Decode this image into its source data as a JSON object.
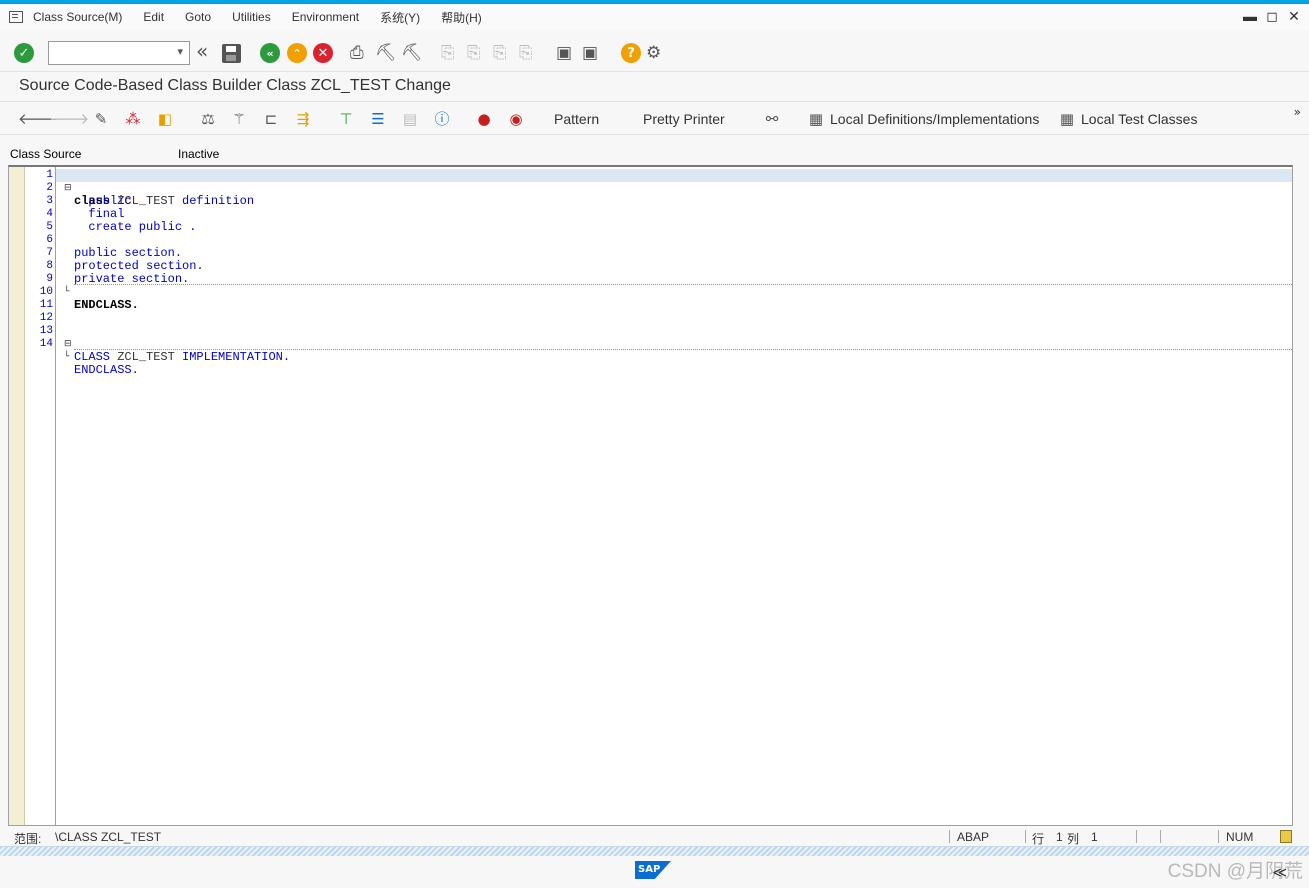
{
  "menubar": {
    "items": [
      "Class Source(M)",
      "Edit",
      "Goto",
      "Utilities",
      "Environment",
      "系统(Y)",
      "帮助(H)"
    ]
  },
  "window_controls": {
    "minimize": "▬",
    "restore": "◻",
    "close": "✕"
  },
  "toolbar": {
    "command_value": "",
    "icons": [
      "enter-icon",
      "command-dropdown-icon",
      "double-left-icon",
      "save-icon",
      "back-icon",
      "exit-icon",
      "cancel-icon",
      "print-icon",
      "find-icon",
      "find-next-icon",
      "first-page-icon",
      "previous-page-icon",
      "next-page-icon",
      "last-page-icon",
      "new-session-icon",
      "shortcut-icon",
      "help-icon",
      "settings-icon"
    ]
  },
  "page": {
    "title": "Source Code-Based Class Builder Class ZCL_TEST Change"
  },
  "app_toolbar": {
    "pattern_label": "Pattern",
    "pretty_printer_label": "Pretty Printer",
    "local_defs_label": "Local Definitions/Implementations",
    "local_tests_label": "Local Test Classes",
    "icons": [
      "back-arrow-icon",
      "forward-arrow-icon",
      "display-change-icon",
      "active-inactive-icon",
      "activate-icon",
      "check-icon",
      "magic-wand-icon",
      "where-used-icon",
      "navigate-icon",
      "hierarchy-icon",
      "outline-icon",
      "layout-icon",
      "info-icon",
      "breakpoint-icon",
      "external-breakpoint-icon",
      "dependency-icon",
      "local-defs-icon",
      "local-tests-icon"
    ],
    "more": "»"
  },
  "header": {
    "source_label": "Class Source",
    "status": "Inactive"
  },
  "editor": {
    "line_numbers": [
      "1",
      "2",
      "3",
      "4",
      "5",
      "6",
      "7",
      "8",
      "9",
      "10",
      "11",
      "12",
      "13",
      "14"
    ],
    "lines": {
      "l1a": "class",
      "l1b": " ZCL_TEST ",
      "l1c": "definition",
      "l2": "  public",
      "l3": "  final",
      "l4": "  create public .",
      "l6": "public section.",
      "l7": "protected section.",
      "l8": "private section.",
      "l9": "ENDCLASS.",
      "l13a": "CLASS",
      "l13b": " ZCL_TEST ",
      "l13c": "IMPLEMENTATION.",
      "l14": "ENDCLASS."
    },
    "fold_open": "⊟",
    "fold_end": "└"
  },
  "statusbar": {
    "scope_label": "范围:",
    "scope_value": "\\CLASS ZCL_TEST",
    "language": "ABAP",
    "row_label": "行",
    "row_value": "1",
    "col_label": "列",
    "col_value": "1",
    "mode": "NUM"
  },
  "footer": {
    "logo": "SAP",
    "watermark": "CSDN @月阴荒",
    "collapse": "≪"
  },
  "colors": {
    "accent": "#00a1e0",
    "keyword": "#0000cc",
    "enter_green": "#2d9a3d",
    "back_green": "#2d9a3d",
    "exit_orange": "#f0a000",
    "cancel_red": "#d9232e",
    "help_orange": "#f0a000"
  }
}
